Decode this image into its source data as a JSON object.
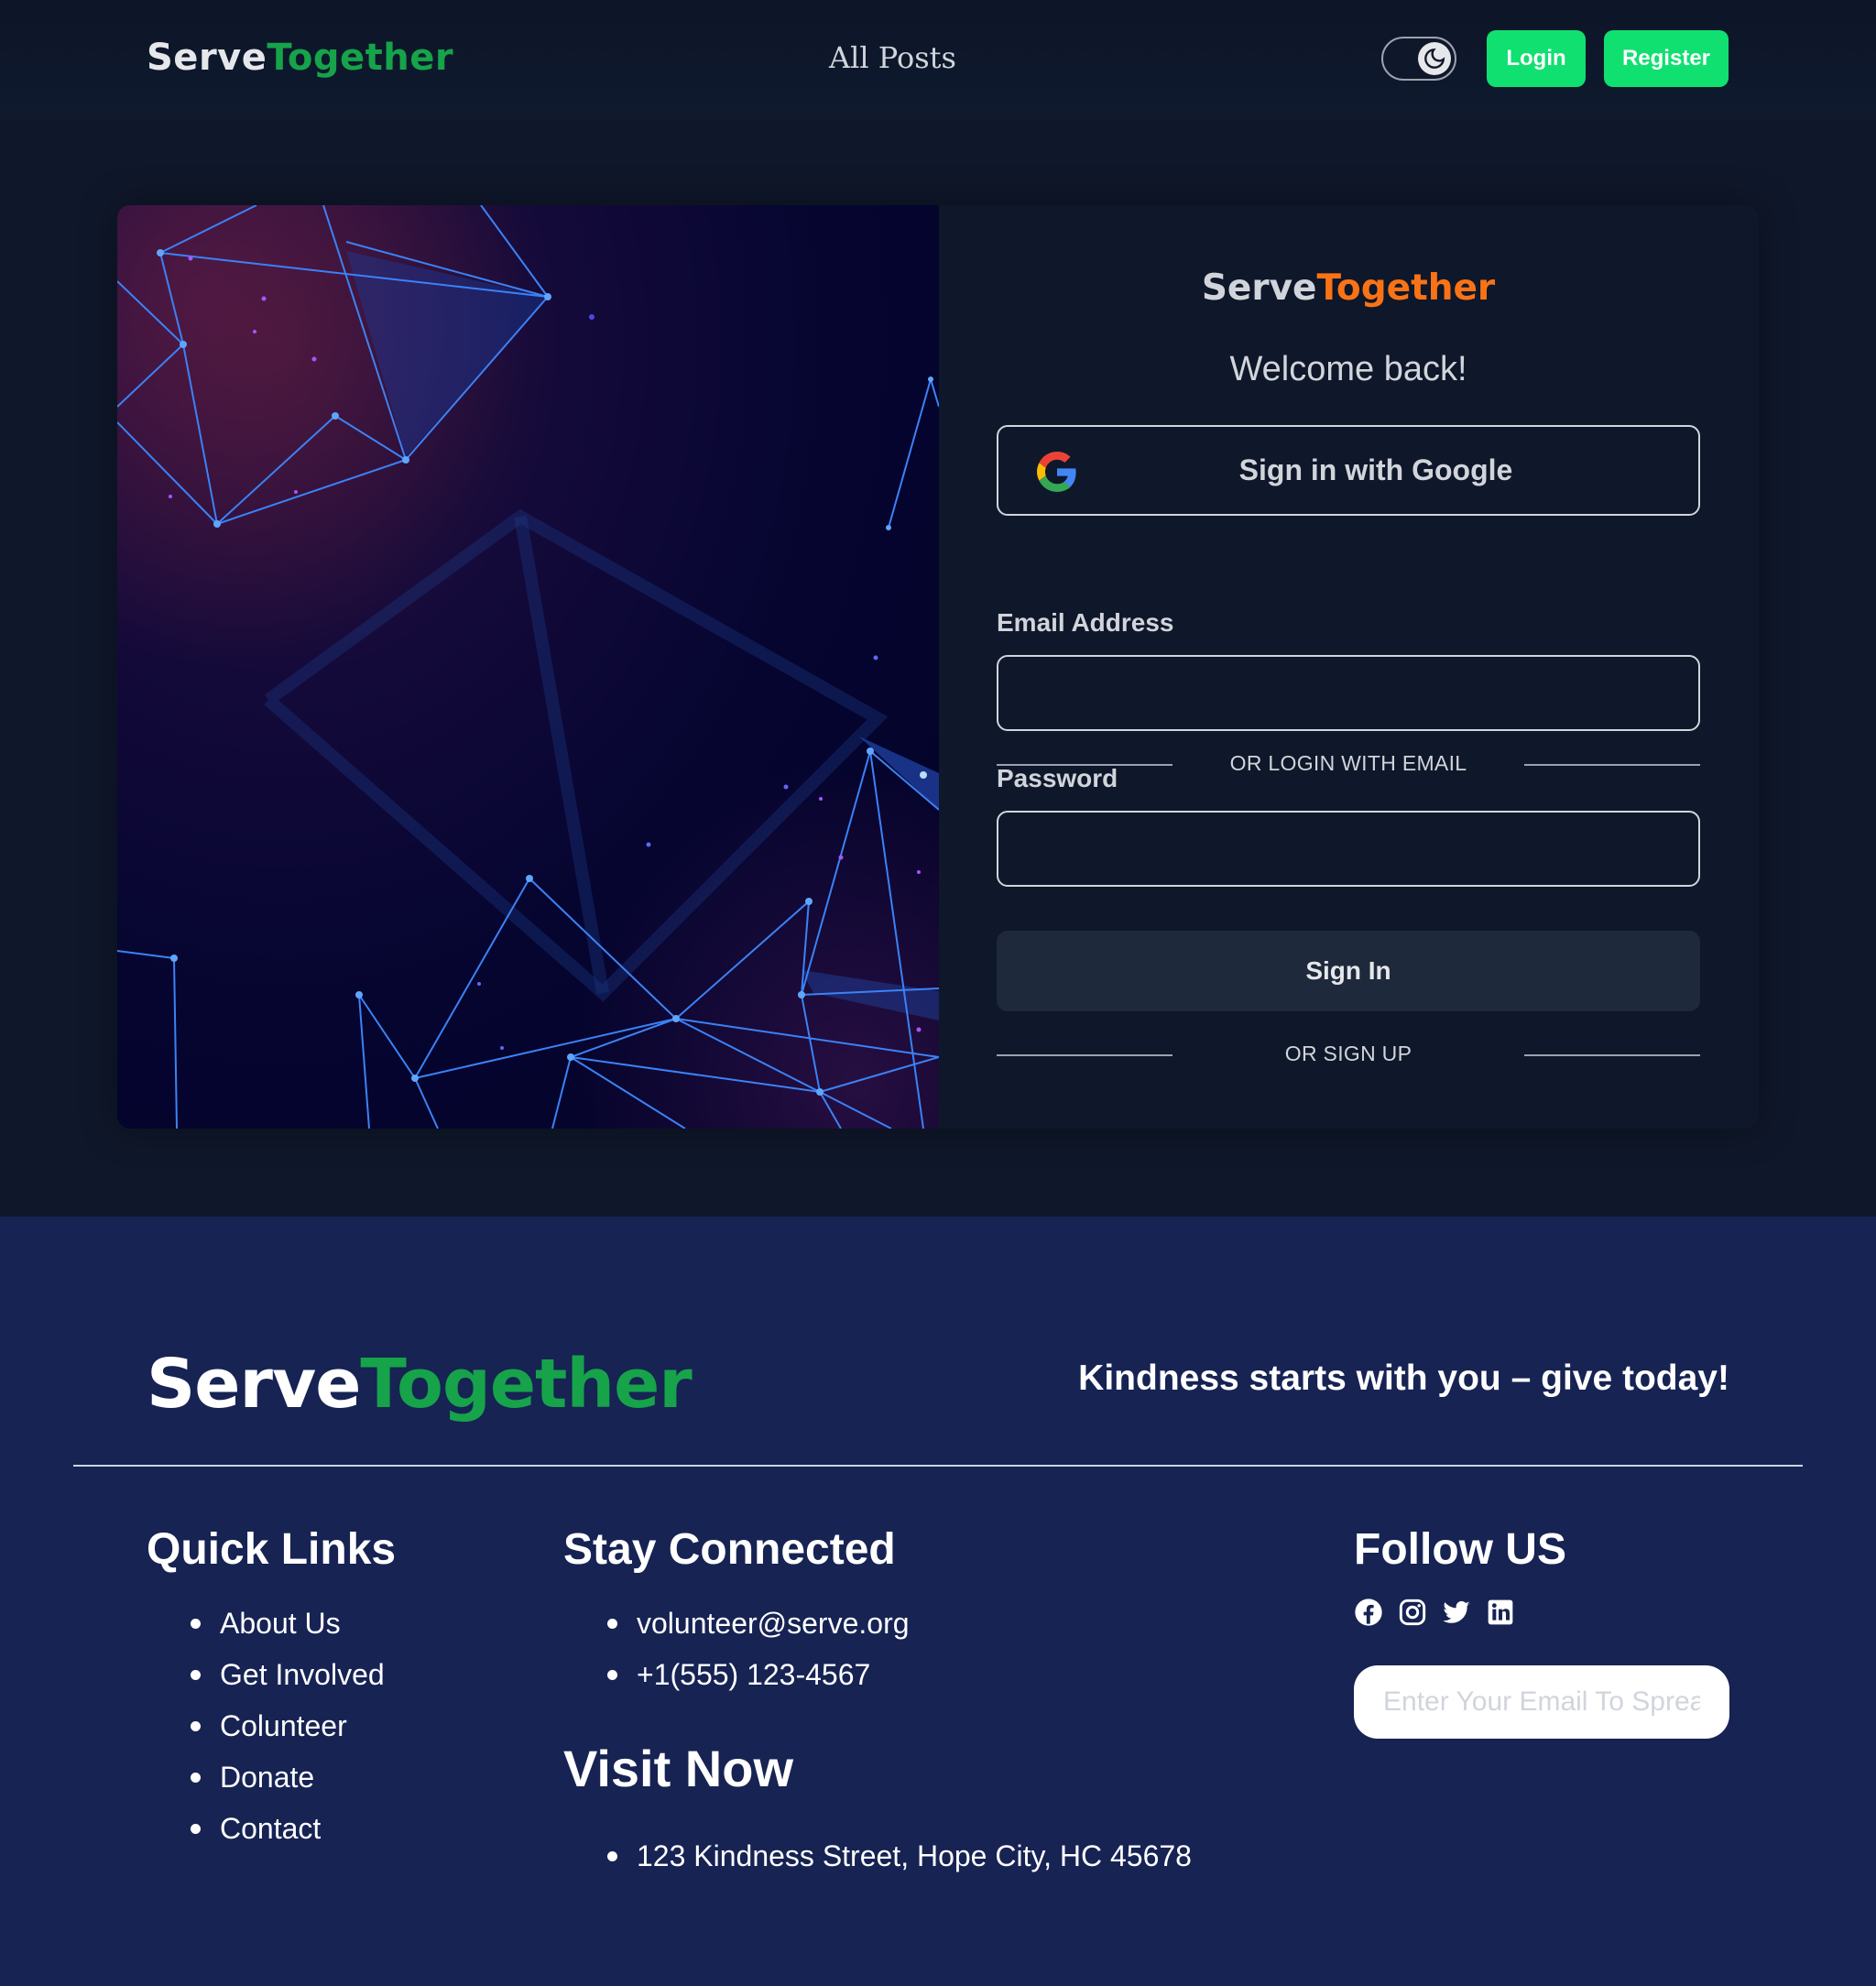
{
  "navbar": {
    "brand_part1": "Serve",
    "brand_part2": "Together",
    "nav_link": "All Posts",
    "login_label": "Login",
    "register_label": "Register"
  },
  "login": {
    "brand_part1": "Serve",
    "brand_part2": "Together",
    "welcome": "Welcome back!",
    "google_label": "Sign in with Google",
    "divider_email": "OR LOGIN WITH EMAIL",
    "email_label": "Email Address",
    "email_value": "",
    "password_label": "Password",
    "password_value": "",
    "signin_label": "Sign In",
    "divider_signup": "OR SIGN UP"
  },
  "footer": {
    "brand_part1": "Serve",
    "brand_part2": "Together",
    "tagline": "Kindness starts with you – give today!",
    "quick_links": {
      "title": "Quick Links",
      "items": [
        "About Us",
        "Get Involved",
        "Colunteer",
        "Donate",
        "Contact"
      ]
    },
    "stay_connected": {
      "title": "Stay Connected",
      "items": [
        "volunteer@serve.org",
        "+1(555) 123-4567"
      ]
    },
    "visit_now": {
      "title": "Visit Now",
      "items": [
        "123 Kindness Street, Hope City, HC 45678"
      ]
    },
    "follow_us": {
      "title": "Follow US",
      "icons": [
        "facebook-icon",
        "instagram-icon",
        "twitter-icon",
        "linkedin-icon"
      ],
      "newsletter_placeholder": "Enter Your Email To Spread"
    }
  },
  "colors": {
    "page_bg": "#0f172a",
    "accent_green": "#10e070",
    "brand_green": "#16a34a",
    "brand_orange": "#f97316",
    "footer_bg": "#162353",
    "signin_bg": "#1e293b"
  }
}
